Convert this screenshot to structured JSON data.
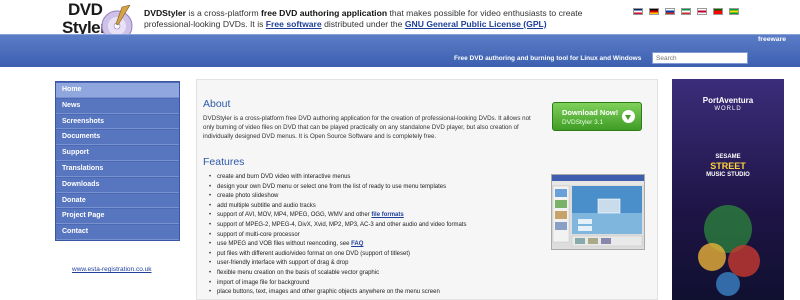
{
  "header": {
    "logo_line1": "DVD",
    "logo_line2": "Styler",
    "intro_app": "DVDStyler",
    "intro_p1": " is a cross-platform ",
    "intro_bold": "free DVD authoring application",
    "intro_p2": " that makes possible for video enthusiasts to create professional-looking DVDs. It is ",
    "intro_link1": "Free software",
    "intro_p3": " distributed under the ",
    "intro_link2": "GNU General Public License (GPL)",
    "flags": [
      {
        "name": "english-flag",
        "colors": [
          "#012169",
          "#ffffff",
          "#c8102e"
        ]
      },
      {
        "name": "german-flag",
        "colors": [
          "#000000",
          "#dd0000",
          "#ffce00"
        ]
      },
      {
        "name": "russian-flag",
        "colors": [
          "#ffffff",
          "#0039a6",
          "#d52b1e"
        ]
      },
      {
        "name": "italian-flag",
        "colors": [
          "#009246",
          "#ffffff",
          "#ce2b37"
        ]
      },
      {
        "name": "japanese-flag",
        "colors": [
          "#ffffff",
          "#bc002d",
          "#ffffff"
        ]
      },
      {
        "name": "portuguese-flag",
        "colors": [
          "#006600",
          "#ff0000",
          "#ff0000"
        ]
      },
      {
        "name": "brazilian-flag",
        "colors": [
          "#009c3b",
          "#ffdf00",
          "#009c3b"
        ]
      }
    ]
  },
  "bar": {
    "freeware": "freeware",
    "tagline": "Free DVD authoring and burning tool for Linux and Windows",
    "search_placeholder": "Search"
  },
  "nav": {
    "items": [
      "Home",
      "News",
      "Screenshots",
      "Documents",
      "Support",
      "Translations",
      "Downloads",
      "Donate",
      "Project Page",
      "Contact"
    ],
    "active_index": 0,
    "esta_link": "www.esta-registration.co.uk"
  },
  "main": {
    "about_title": "About",
    "about_text": "DVDStyler is a cross-platform free DVD authoring application for the creation of professional-looking DVDs. It allows not only burning of video files on DVD that can be played practically on any standalone DVD player, but also creation of individually designed DVD menus. It is Open Source Software and is completely free.",
    "download_label": "Download Now!",
    "download_version": "DVDStyler 3.1",
    "features_title": "Features",
    "features": [
      {
        "text": "create and burn DVD video with interactive menus"
      },
      {
        "text": "design your own DVD menu or select one from the list of ready to use menu templates"
      },
      {
        "text": "create photo slideshow"
      },
      {
        "text": "add multiple subtitle and audio tracks"
      },
      {
        "text": "support of AVI, MOV, MP4, MPEG, OGG, WMV and other ",
        "link": "file formats"
      },
      {
        "text": "support of MPEG-2, MPEG-4, DivX, Xvid, MP2, MP3, AC-3 and other audio and video formats"
      },
      {
        "text": "support of multi-core processor"
      },
      {
        "text": "use MPEG and VOB files without reencoding, see ",
        "link": "FAQ"
      },
      {
        "text": "put files with different audio/video format on one DVD (support of titleset)"
      },
      {
        "text": "user-friendly interface with support of drag & drop"
      },
      {
        "text": "flexible menu creation on the basis of scalable vector graphic"
      },
      {
        "text": "import of image file for background"
      },
      {
        "text": "place buttons, text, images and other graphic objects anywhere on the menu screen"
      }
    ]
  },
  "ad": {
    "brand1_top": "PortAventura",
    "brand1_bottom": "WORLD",
    "brand2_top": "SESAME",
    "brand2_mid": "STREET",
    "brand2_bottom": "MUSIC STUDIO"
  },
  "colors": {
    "bar_blue": "#4a6cbc",
    "nav_blue": "#5876c0",
    "link_blue": "#1f3f9a",
    "heading_blue": "#2e5aa8",
    "download_green": "#4faf2c"
  }
}
